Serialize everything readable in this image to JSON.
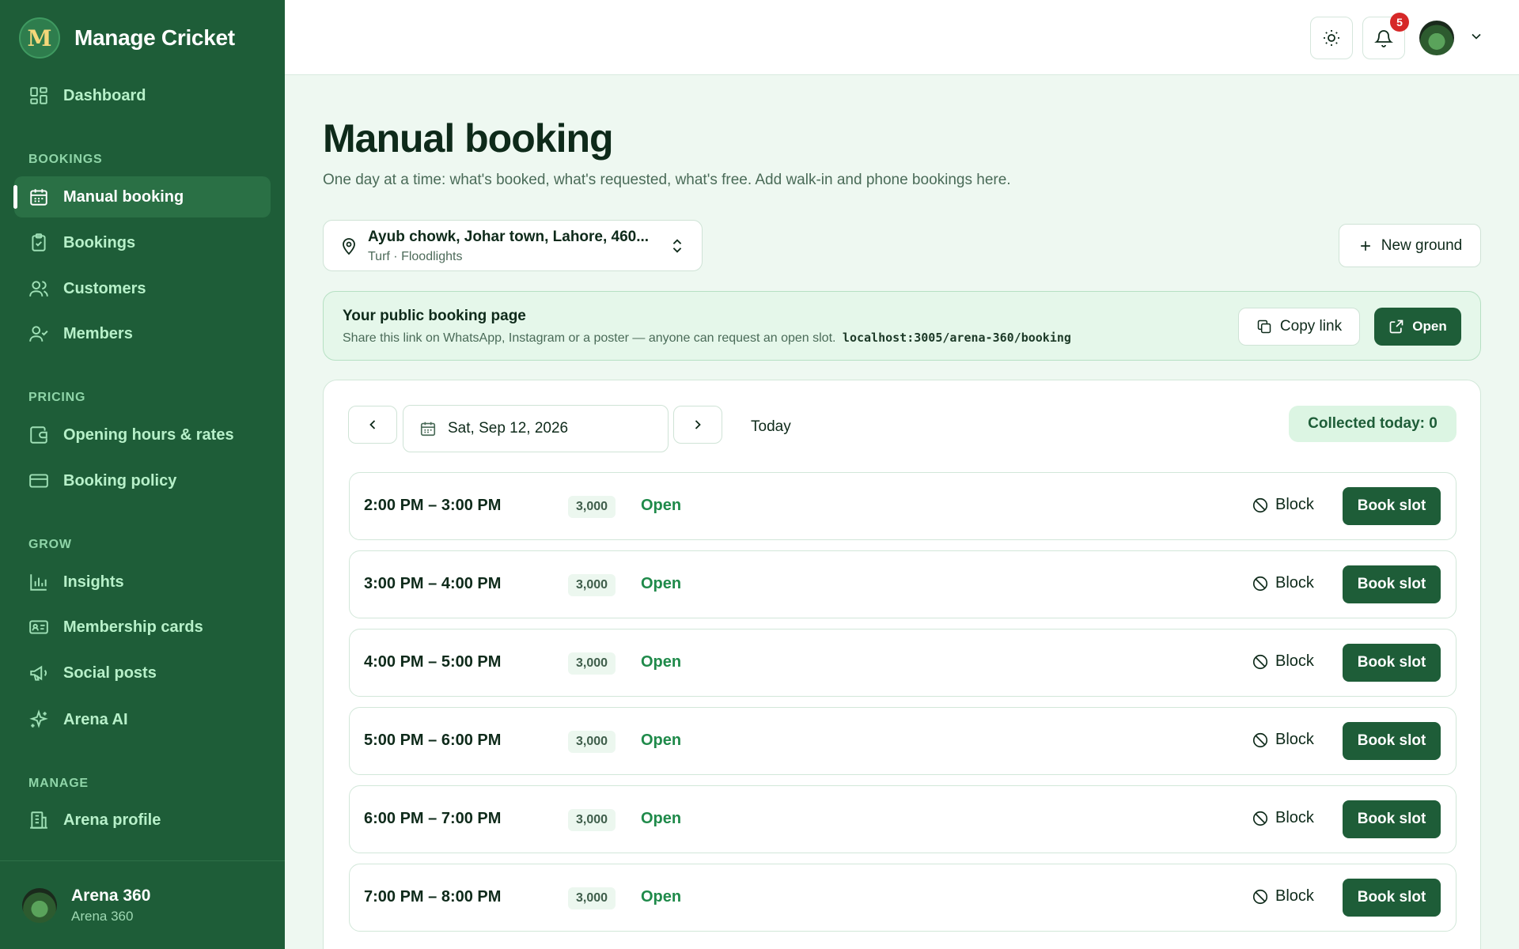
{
  "brand": {
    "name": "Manage Cricket",
    "logo_letter": "M"
  },
  "sidebar": {
    "items": [
      {
        "label": "Dashboard",
        "icon": "dashboard-icon"
      },
      {
        "label": "Manual booking",
        "icon": "calendar-icon",
        "active": true
      },
      {
        "label": "Bookings",
        "icon": "clipboard-icon"
      },
      {
        "label": "Customers",
        "icon": "users-icon"
      },
      {
        "label": "Members",
        "icon": "user-check-icon"
      },
      {
        "label": "Opening hours & rates",
        "icon": "wallet-icon"
      },
      {
        "label": "Booking policy",
        "icon": "card-icon"
      },
      {
        "label": "Insights",
        "icon": "bar-chart-icon"
      },
      {
        "label": "Membership cards",
        "icon": "id-card-icon"
      },
      {
        "label": "Social posts",
        "icon": "megaphone-icon"
      },
      {
        "label": "Arena AI",
        "icon": "sparkles-icon"
      },
      {
        "label": "Arena profile",
        "icon": "building-icon"
      }
    ],
    "sections": {
      "bookings": "BOOKINGS",
      "pricing": "PRICING",
      "grow": "GROW",
      "manage": "MANAGE"
    },
    "footer": {
      "name": "Arena 360",
      "subtitle": "Arena 360"
    }
  },
  "header": {
    "notification_count": "5"
  },
  "page": {
    "title": "Manual booking",
    "subtitle": "One day at a time: what's booked, what's requested, what's free. Add walk-in and phone bookings here."
  },
  "ground": {
    "name": "Ayub chowk, Johar town, Lahore, 460...",
    "meta": "Turf · Floodlights",
    "new_label": "New ground"
  },
  "public_page": {
    "title": "Your public booking page",
    "description": "Share this link on WhatsApp, Instagram or a poster — anyone can request an open slot.",
    "url": "localhost:3005/arena-360/booking",
    "copy_label": "Copy link",
    "open_label": "Open"
  },
  "schedule": {
    "date": "Sat, Sep 12, 2026",
    "today_label": "Today",
    "collected": "Collected today: 0",
    "block_label": "Block",
    "book_label": "Book slot",
    "slots": [
      {
        "time": "2:00 PM – 3:00 PM",
        "price": "3,000",
        "status": "Open"
      },
      {
        "time": "3:00 PM – 4:00 PM",
        "price": "3,000",
        "status": "Open"
      },
      {
        "time": "4:00 PM – 5:00 PM",
        "price": "3,000",
        "status": "Open"
      },
      {
        "time": "5:00 PM – 6:00 PM",
        "price": "3,000",
        "status": "Open"
      },
      {
        "time": "6:00 PM – 7:00 PM",
        "price": "3,000",
        "status": "Open"
      },
      {
        "time": "7:00 PM – 8:00 PM",
        "price": "3,000",
        "status": "Open"
      }
    ]
  },
  "colors": {
    "sidebar": "#1e5d38",
    "accent": "#1e5d38",
    "open_status": "#1f8a4a",
    "badge": "#d62828"
  }
}
